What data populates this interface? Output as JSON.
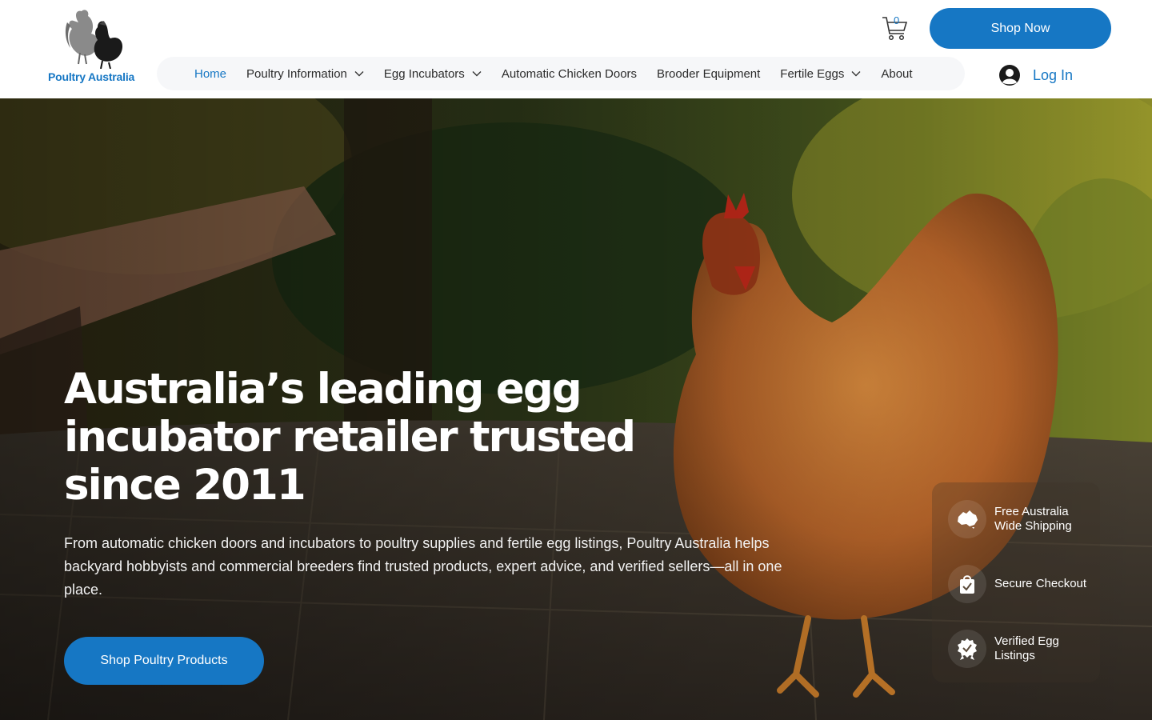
{
  "brand": {
    "name": "Poultry Australia"
  },
  "cart": {
    "count": "0"
  },
  "header": {
    "shop_now_label": "Shop Now",
    "login_label": "Log In"
  },
  "nav": {
    "items": [
      {
        "label": "Home",
        "active": true,
        "has_dropdown": false
      },
      {
        "label": "Poultry Information",
        "active": false,
        "has_dropdown": true
      },
      {
        "label": "Egg Incubators",
        "active": false,
        "has_dropdown": true
      },
      {
        "label": "Automatic Chicken Doors",
        "active": false,
        "has_dropdown": false
      },
      {
        "label": "Brooder Equipment",
        "active": false,
        "has_dropdown": false
      },
      {
        "label": "Fertile Eggs",
        "active": false,
        "has_dropdown": true
      },
      {
        "label": "About",
        "active": false,
        "has_dropdown": false
      }
    ]
  },
  "hero": {
    "title": "Australia’s leading egg incubator retailer trusted since 2011",
    "description": "From automatic chicken doors and incubators to poultry supplies and fertile egg listings, Poultry Australia helps backyard hobbyists and commercial breeders find trusted products, expert advice, and verified sellers—all in one place.",
    "cta_label": "Shop Poultry Products"
  },
  "features": [
    {
      "label": "Free Australia Wide Shipping",
      "icon": "australia-map-icon"
    },
    {
      "label": "Secure Checkout",
      "icon": "shopping-bag-check-icon"
    },
    {
      "label": "Verified Egg Listings",
      "icon": "verified-badge-icon"
    }
  ],
  "colors": {
    "brand_blue": "#1677c4",
    "nav_bg": "#f6f7f9"
  }
}
